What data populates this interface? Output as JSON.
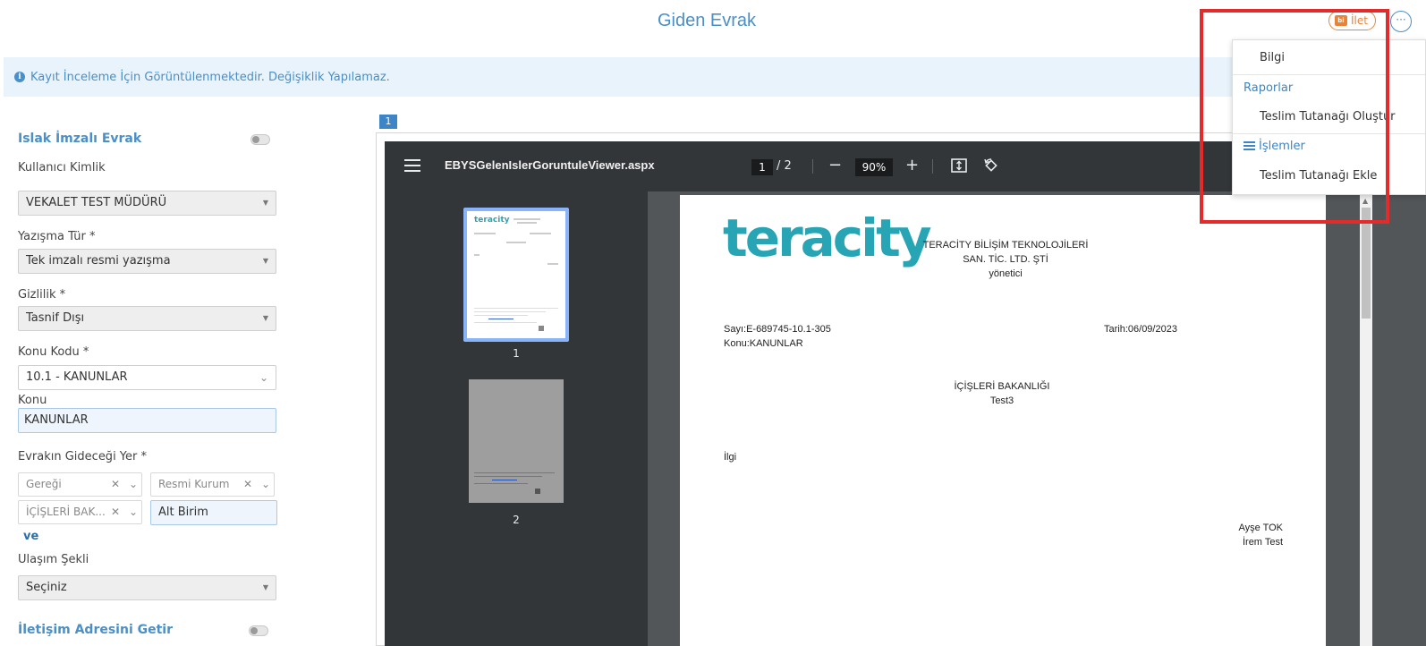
{
  "header": {
    "title": "Giden Evrak",
    "forward_label": "İlet",
    "forward_icon": "forward-icon",
    "more_icon": "···"
  },
  "notice": {
    "text": "Kayıt İnceleme İçin Görüntülenmektedir. Değişiklik Yapılamaz."
  },
  "form": {
    "wet_signed_title": "Islak İmzalı Evrak",
    "user_identity_label": "Kullanıcı Kimlik",
    "user_identity_value": "VEKALET TEST MÜDÜRÜ",
    "correspondence_type_label": "Yazışma Tür *",
    "correspondence_type_value": "Tek imzalı resmi yazışma",
    "confidentiality_label": "Gizlilik *",
    "confidentiality_value": "Tasnif Dışı",
    "subject_code_label": "Konu Kodu *",
    "subject_code_value": "10.1 - KANUNLAR",
    "subject_label": "Konu",
    "subject_value": "KANUNLAR",
    "destination_label": "Evrakın Gideceği Yer *",
    "dest_gere": "Gereği",
    "dest_resmi": "Resmi Kurum",
    "dest_icisleri": "İÇİŞLERİ BAK...",
    "dest_alt_birim_placeholder": "Alt Birim",
    "and_link": "ve",
    "delivery_label": "Ulaşım Şekli",
    "delivery_value": "Seçiniz",
    "contact_address_title": "İletişim Adresini Getir"
  },
  "viewer": {
    "page_chip": "1",
    "file_name": "EBYSGelenIslerGoruntuleViewer.aspx",
    "current_page": "1",
    "total_pages": "/ 2",
    "zoom": "90%",
    "thumbnails": [
      "1",
      "2"
    ]
  },
  "document": {
    "logo": "teracity",
    "company_line1": "TERACİTY BİLİŞİM TEKNOLOJİLERİ",
    "company_line2": "SAN. TİC. LTD. ŞTİ",
    "company_line3": "yönetici",
    "number": "Sayı:E-689745-10.1-305",
    "subject": "Konu:KANUNLAR",
    "date": "Tarih:06/09/2023",
    "recipient_line1": "İÇİŞLERİ BAKANLIĞI",
    "recipient_line2": "Test3",
    "reference": "İlgi",
    "signer1": "Ayşe TOK",
    "signer2": "İrem Test"
  },
  "menu": {
    "info": "Bilgi",
    "reports_header": "Raporlar",
    "create_delivery_report": "Teslim Tutanağı Oluştur",
    "operations_header": "İşlemler",
    "add_delivery_report": "Teslim Tutanağı Ekle"
  },
  "colors": {
    "accent": "#4a8fc7",
    "forward": "#e8843a",
    "highlight": "#e32b2b",
    "logo": "#27a5b4"
  }
}
